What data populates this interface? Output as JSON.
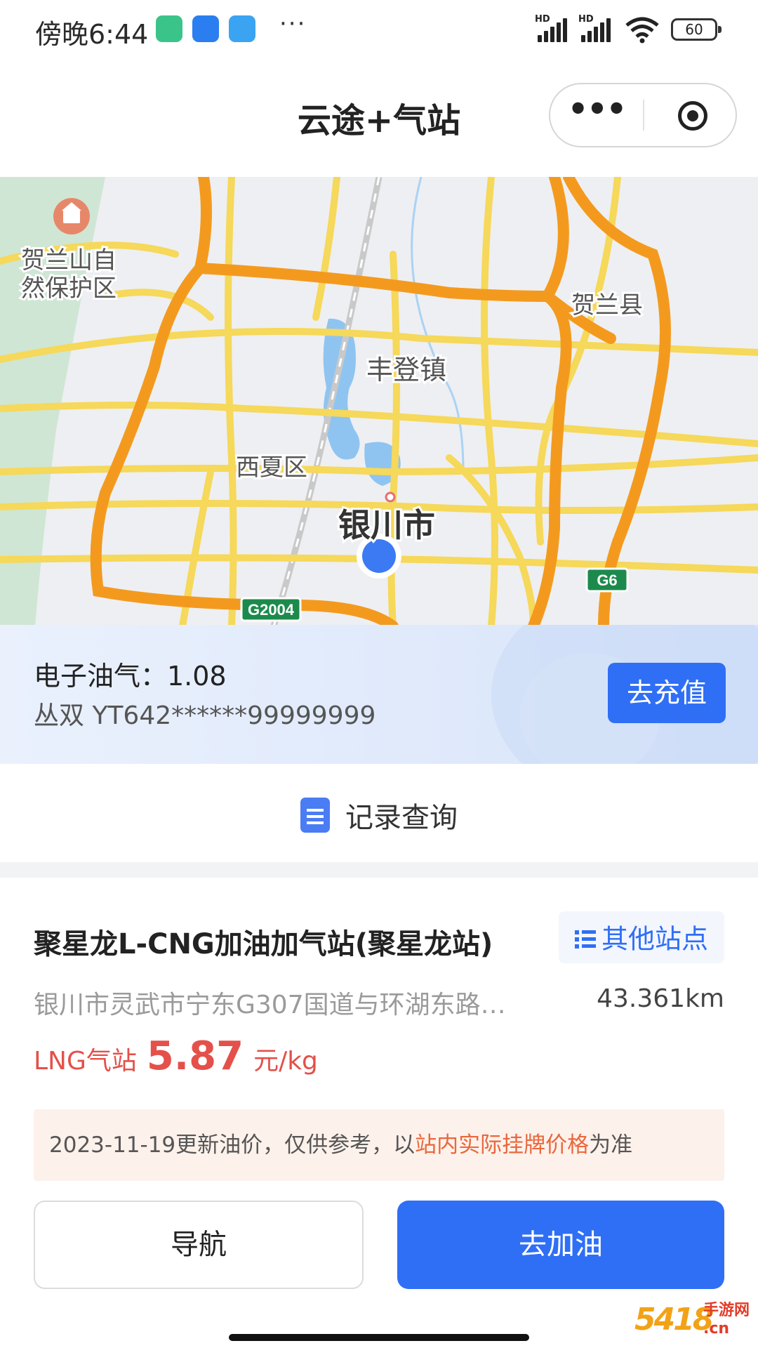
{
  "status_bar": {
    "time": "傍晚6:44",
    "more": "···",
    "battery": "60",
    "signal_label": "HD"
  },
  "nav": {
    "title": "云途+气站",
    "more_label": "•••"
  },
  "map": {
    "labels": {
      "reserve": "贺兰山自然保护区",
      "reserve_l1": "贺兰山自",
      "reserve_l2": "然保护区",
      "helan": "贺兰县",
      "fengdeng": "丰登镇",
      "xixia": "西夏区",
      "yinchuan": "银川市",
      "g2004": "G2004",
      "g6": "G6"
    },
    "colors": {
      "ring_road": "#f39a1e",
      "road": "#f6d85a",
      "water": "#8fc4f0",
      "greenery": "#cde5d2",
      "location_dot": "#3b7af2"
    }
  },
  "balance": {
    "line1": "电子油气：1.08",
    "line2": "丛双 YT642******99999999",
    "recharge_label": "去充值"
  },
  "records": {
    "label": "记录查询"
  },
  "station": {
    "name": "聚星龙L-CNG加油加气站(聚星龙站)",
    "other_label": "其他站点",
    "address": "银川市灵武市宁东G307国道与环湖东路…",
    "distance": "43.361km",
    "price_label": "LNG气站",
    "price_value": "5.87",
    "price_unit": "元/kg",
    "notice_prefix": "2023-11-19更新油价，仅供参考，以",
    "notice_highlight": "站内实际挂牌价格",
    "notice_suffix": "为准",
    "nav_button": "导航",
    "go_button": "去加油"
  },
  "watermark": {
    "logo": "5418",
    "site_top": "手游网",
    "site_bottom": ".cn"
  }
}
